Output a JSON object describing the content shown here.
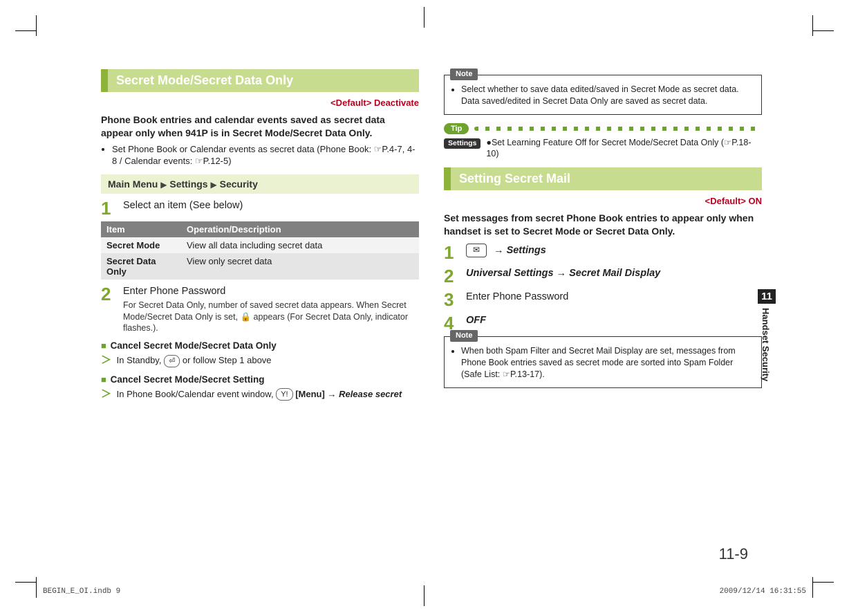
{
  "left": {
    "headerTitle": "Secret Mode/Secret Data Only",
    "defaultLabel": "<Default> Deactivate",
    "intro": "Phone Book entries and calendar events saved as secret data appear only when 941P is in Secret Mode/Secret Data Only.",
    "bullet1": "Set Phone Book or Calendar events as secret data (Phone Book: ☞P.4-7, 4-8 / Calendar events: ☞P.12-5)",
    "menu_prefix": "Main Menu",
    "menu_tri1": "▶",
    "menu_settings": "Settings",
    "menu_tri2": "▶",
    "menu_security": "Security",
    "step1_num": "1",
    "step1_text": "Select an item (See below)",
    "table": {
      "h1": "Item",
      "h2": "Operation/Description",
      "r1c1": "Secret Mode",
      "r1c2": "View all data including secret data",
      "r2c1": "Secret Data Only",
      "r2c2": "View only secret data"
    },
    "step2_num": "2",
    "step2_text": "Enter Phone Password",
    "step2_sub": "For Secret Data Only, number of saved secret data appears. When Secret Mode/Secret Data Only is set, 🔒 appears (For Secret Data Only, indicator flashes.).",
    "subA_sq": "■",
    "subA_title": "Cancel Secret Mode/Secret Data Only",
    "subA_gt": "＞",
    "subA_text_a": "In Standby, ",
    "subA_btn": "⏎",
    "subA_text_b": " or follow Step 1 above",
    "subB_sq": "■",
    "subB_title": "Cancel Secret Mode/Secret Setting",
    "subB_gt": "＞",
    "subB_text_a": "In Phone Book/Calendar event window, ",
    "subB_btn": "Y!",
    "subB_menu": "[Menu]",
    "subB_arrow": " → ",
    "subB_release": "Release secret"
  },
  "right": {
    "note1_label": "Note",
    "note1_item": "Select whether to save data edited/saved in Secret Mode as secret data. Data saved/edited in Secret Data Only are saved as secret data.",
    "tip_label": "Tip",
    "settings_label": "Settings",
    "settings_text": "●Set Learning Feature Off for Secret Mode/Secret Data Only (☞P.18-10)",
    "headerTitle": "Setting Secret Mail",
    "defaultLabel": "<Default> ON",
    "intro": "Set messages from secret Phone Book entries to appear only when handset is set to Secret Mode or Secret Data Only.",
    "step1_num": "1",
    "step1_arrow": " → ",
    "step1_settings": "Settings",
    "step2_num": "2",
    "step2_uni": "Universal Settings",
    "step2_arrow": " → ",
    "step2_smd": "Secret Mail Display",
    "step3_num": "3",
    "step3_text": "Enter Phone Password",
    "step4_num": "4",
    "step4_text": "OFF",
    "note2_label": "Note",
    "note2_item": "When both Spam Filter and Secret Mail Display are set, messages from Phone Book entries saved as secret mode are sorted into Spam Folder (Safe List: ☞P.13-17)."
  },
  "sideTab": {
    "num": "11",
    "text": "Handset Security"
  },
  "pageNum": "11-9",
  "footer": {
    "left": "BEGIN_E_OI.indb   9",
    "right": "2009/12/14   16:31:55"
  }
}
